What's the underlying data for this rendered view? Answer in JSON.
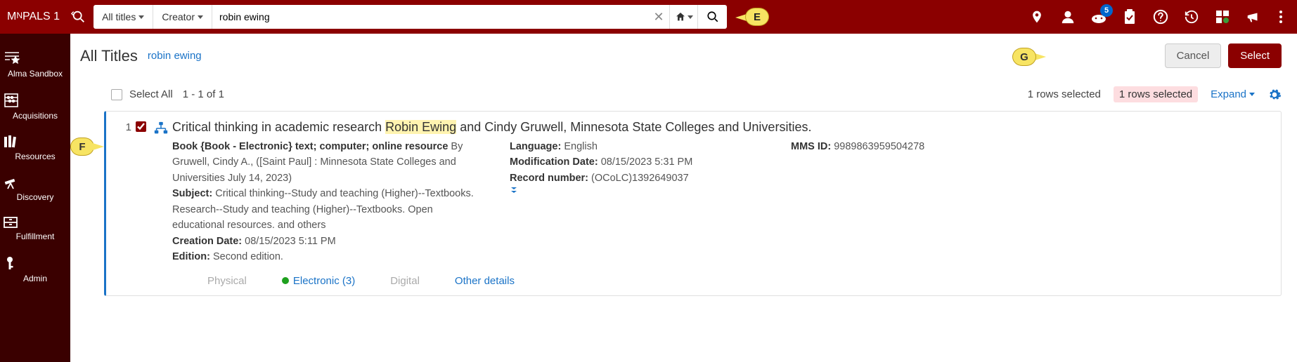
{
  "header": {
    "logo_main": "M",
    "logo_small1": "N",
    "logo_mid": "PALS",
    "logo_small2": " 1",
    "search_scope": "All titles",
    "search_field": "Creator",
    "search_value": "robin ewing",
    "badge_count": "5"
  },
  "sidebar": {
    "items": [
      {
        "label": "Alma Sandbox"
      },
      {
        "label": "Acquisitions"
      },
      {
        "label": "Resources"
      },
      {
        "label": "Discovery"
      },
      {
        "label": "Fulfillment"
      },
      {
        "label": "Admin"
      }
    ]
  },
  "page": {
    "title": "All Titles",
    "subtitle_link": "robin ewing",
    "cancel_label": "Cancel",
    "select_label": "Select"
  },
  "toolbar": {
    "select_all_label": "Select All",
    "count_label": "1 - 1 of 1",
    "rows_selected_plain": "1 rows selected",
    "rows_selected_tag": "1 rows selected",
    "expand_label": "Expand"
  },
  "result": {
    "index": "1",
    "title_pre": "Critical thinking in academic research ",
    "title_highlight": "Robin Ewing",
    "title_post": " and Cindy Gruwell, Minnesota State Colleges and Universities.",
    "type_line_bold": "Book {Book - Electronic} text; computer; online resource",
    "type_line_rest": " By Gruwell, Cindy A., ([Saint Paul] : Minnesota State Colleges and Universities July 14, 2023)",
    "subject_label": "Subject:",
    "subject_value": " Critical thinking--Study and teaching (Higher)--Textbooks. Research--Study and teaching (Higher)--Textbooks. Open educational resources. and others",
    "creation_label": "Creation Date:",
    "creation_value": " 08/15/2023 5:11 PM",
    "edition_label": "Edition:",
    "edition_value": " Second edition.",
    "language_label": "Language:",
    "language_value": " English",
    "moddate_label": "Modification Date:",
    "moddate_value": " 08/15/2023 5:31 PM",
    "recnum_label": "Record number:",
    "recnum_value": " (OCoLC)1392649037",
    "mmsid_label": "MMS ID:",
    "mmsid_value": " 9989863959504278",
    "tabs": {
      "physical": "Physical",
      "electronic": "Electronic (3)",
      "digital": "Digital",
      "other": "Other details"
    }
  },
  "annotations": {
    "E": "E",
    "F": "F",
    "G": "G"
  }
}
